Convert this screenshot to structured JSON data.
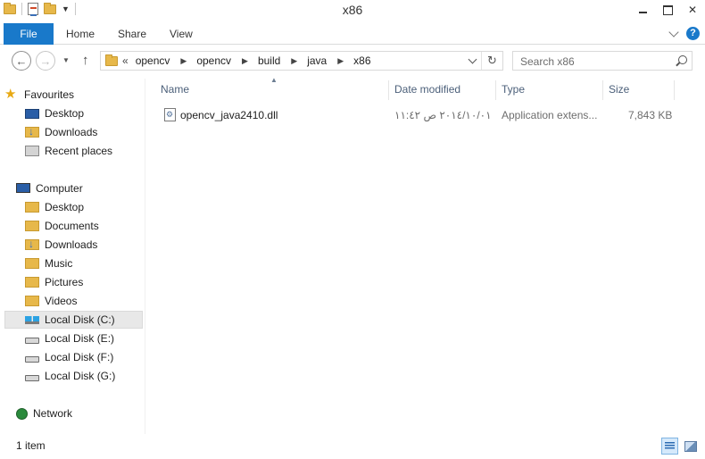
{
  "window": {
    "title": "x86"
  },
  "ribbon": {
    "tabs": [
      "File",
      "Home",
      "Share",
      "View"
    ]
  },
  "address": {
    "lead": "«",
    "crumbs": [
      "opencv",
      "opencv",
      "build",
      "java",
      "x86"
    ]
  },
  "search": {
    "placeholder": "Search x86"
  },
  "nav": {
    "favourites": {
      "label": "Favourites",
      "items": [
        "Desktop",
        "Downloads",
        "Recent places"
      ]
    },
    "computer": {
      "label": "Computer",
      "items": [
        "Desktop",
        "Documents",
        "Downloads",
        "Music",
        "Pictures",
        "Videos",
        "Local Disk (C:)",
        "Local Disk (E:)",
        "Local Disk (F:)",
        "Local Disk (G:)"
      ],
      "selected": "Local Disk (C:)"
    },
    "network": {
      "label": "Network"
    }
  },
  "columns": {
    "name": "Name",
    "date": "Date modified",
    "type": "Type",
    "size": "Size"
  },
  "files": [
    {
      "name": "opencv_java2410.dll",
      "date": "٢٠١٤/١٠/٠١ ص ١١:٤٢",
      "type": "Application extens...",
      "size": "7,843 KB"
    }
  ],
  "status": {
    "item_count": "1 item"
  },
  "colors": {
    "accent": "#1979ca",
    "selected_bg": "#e8e8e8",
    "header_text": "#4c607a"
  }
}
